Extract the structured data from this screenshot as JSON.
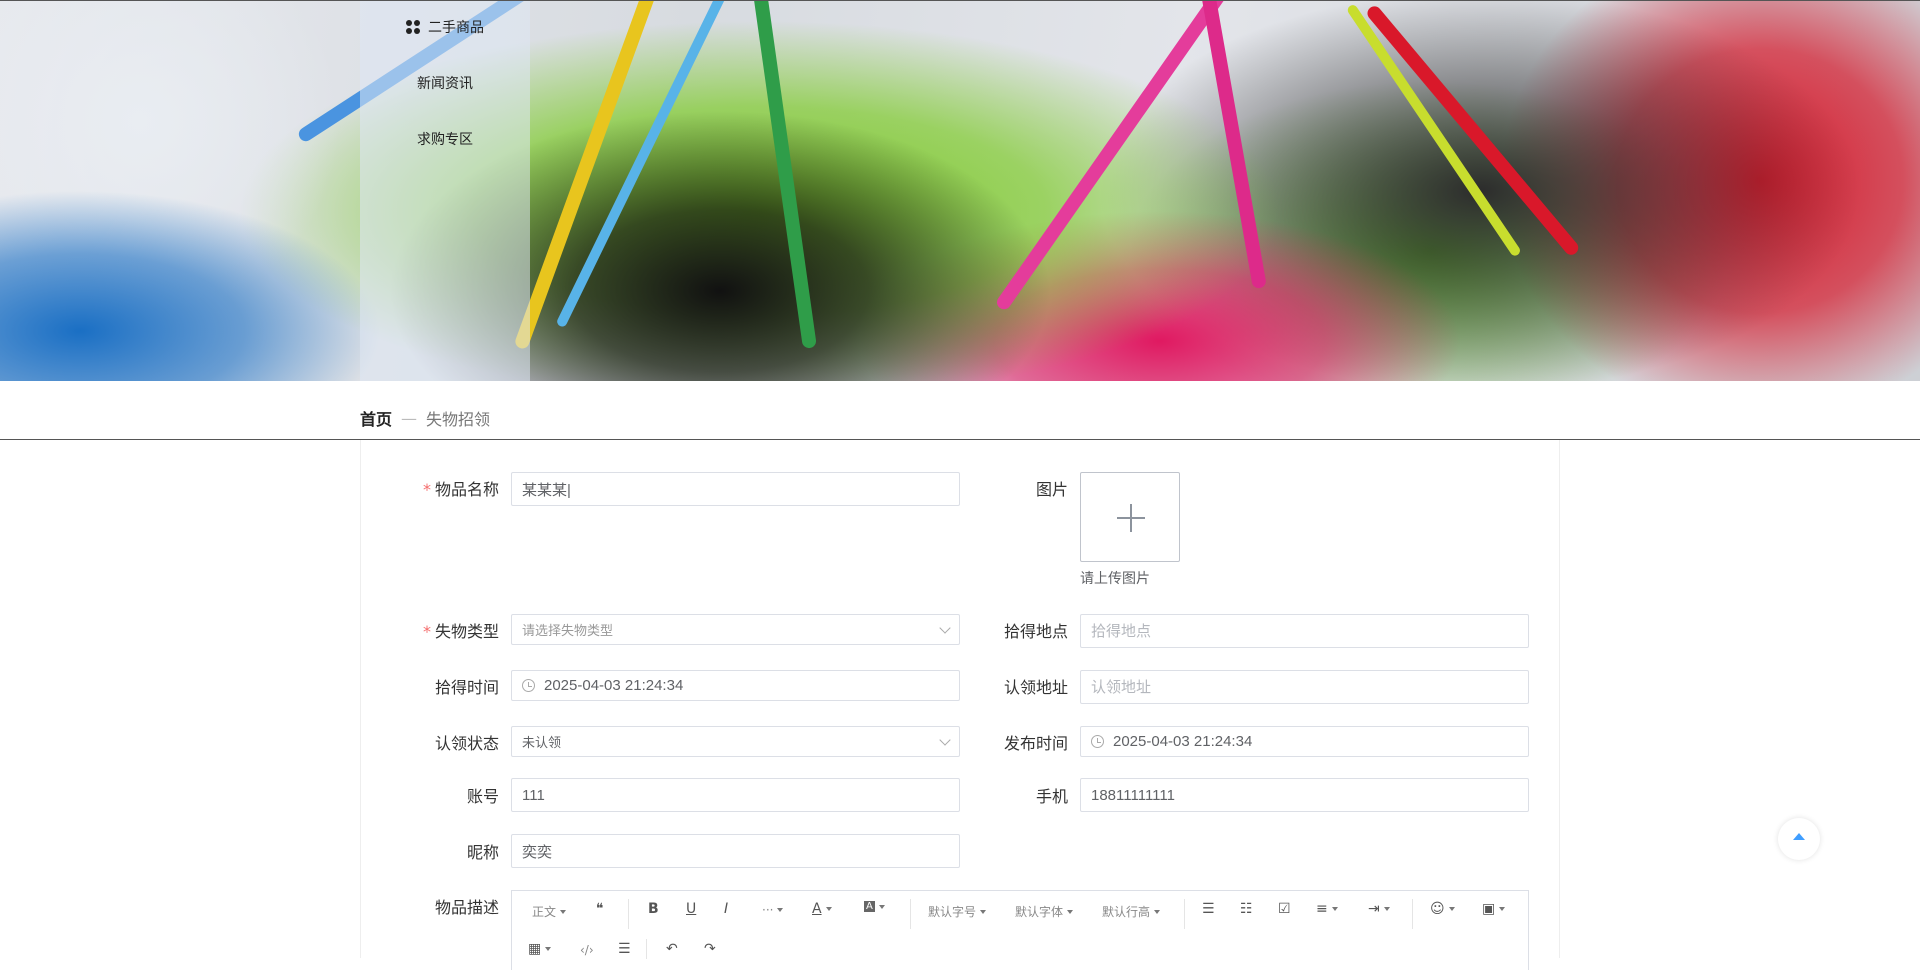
{
  "sidebar": {
    "items": [
      {
        "label": "二手商品",
        "icon": "grid-dots-icon"
      },
      {
        "label": "新闻资讯"
      },
      {
        "label": "求购专区"
      }
    ]
  },
  "breadcrumb": {
    "home": "首页",
    "separator": "—",
    "current": "失物招领"
  },
  "form": {
    "item_name": {
      "label": "物品名称",
      "required": "*",
      "value": "某某某|"
    },
    "image": {
      "label": "图片",
      "tip": "请上传图片"
    },
    "lost_type": {
      "label": "失物类型",
      "required": "*",
      "placeholder": "请选择失物类型"
    },
    "found_place": {
      "label": "拾得地点",
      "placeholder": "拾得地点"
    },
    "found_time": {
      "label": "拾得时间",
      "value": "2025-04-03 21:24:34"
    },
    "claim_address": {
      "label": "认领地址",
      "placeholder": "认领地址"
    },
    "claim_status": {
      "label": "认领状态",
      "value": "未认领"
    },
    "publish_time": {
      "label": "发布时间",
      "value": "2025-04-03 21:24:34"
    },
    "account": {
      "label": "账号",
      "value": "111"
    },
    "phone": {
      "label": "手机",
      "value": "18811111111"
    },
    "nickname": {
      "label": "昵称",
      "value": "奕奕"
    },
    "description": {
      "label": "物品描述"
    }
  },
  "editor": {
    "toolbar": {
      "paragraph": "正文",
      "quote": "❝",
      "bold": "B",
      "underline": "U",
      "italic": "I",
      "more": "···",
      "font_color": "A",
      "bg_color": "A",
      "font_size": "默认字号",
      "font_family": "默认字体",
      "line_height": "默认行高",
      "bullet_list": "☰",
      "numbered_list": "☷",
      "todo": "☑",
      "align": "≡",
      "indent": "⇥",
      "emoji": "☺",
      "image": "▣",
      "table": "▦",
      "code": "‹/›",
      "divider": "☰",
      "undo": "↶",
      "redo": "↷"
    }
  },
  "colors": {
    "required": "#f56c6c",
    "border": "#dcdfe6",
    "accent": "#409eff"
  }
}
